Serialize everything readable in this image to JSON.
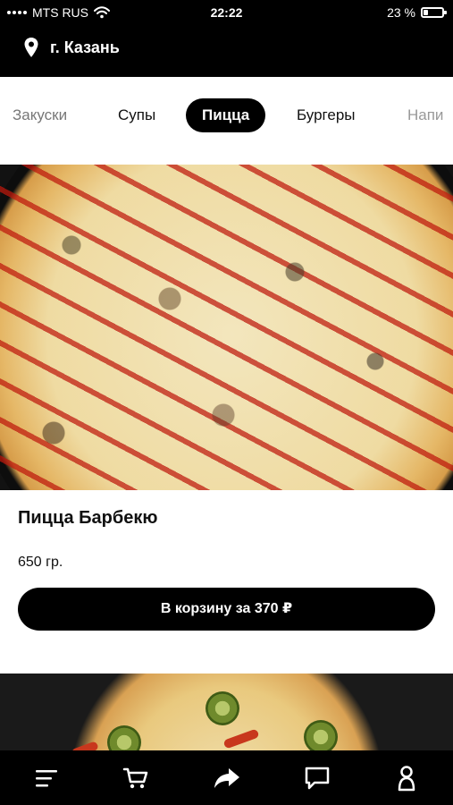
{
  "status_bar": {
    "carrier": "MTS RUS",
    "time": "22:22",
    "battery_percent": "23 %",
    "battery_level": 0.23
  },
  "header": {
    "location_icon": "location-pin-icon",
    "city": "г. Казань"
  },
  "categories": [
    {
      "label": "Закуски",
      "active": false
    },
    {
      "label": "Супы",
      "active": false
    },
    {
      "label": "Пицца",
      "active": true
    },
    {
      "label": "Бургеры",
      "active": false
    },
    {
      "label": "Напи",
      "active": false
    }
  ],
  "product": {
    "name": "Пицца Барбекю",
    "weight": "650 гр.",
    "button_label": "В корзину за 370 ₽"
  },
  "bottom_nav": [
    {
      "icon": "menu-icon"
    },
    {
      "icon": "cart-icon"
    },
    {
      "icon": "share-icon"
    },
    {
      "icon": "chat-icon"
    },
    {
      "icon": "profile-icon"
    }
  ],
  "colors": {
    "accent": "#000000",
    "background": "#ffffff",
    "text": "#111111"
  }
}
